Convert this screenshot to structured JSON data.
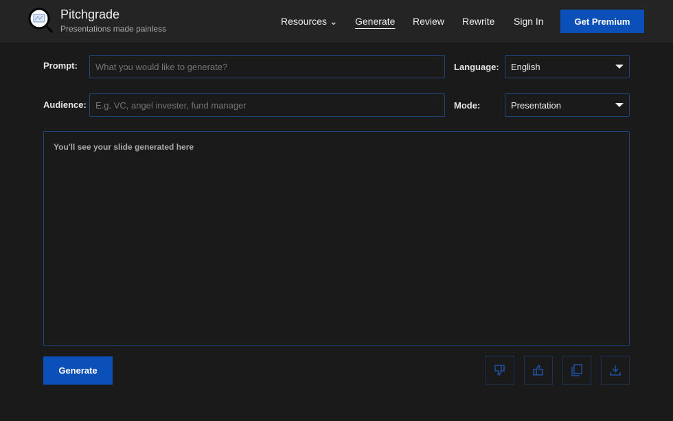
{
  "header": {
    "brand": "Pitchgrade",
    "tagline": "Presentations made painless",
    "nav": [
      {
        "label": "Resources"
      },
      {
        "label": "Generate"
      },
      {
        "label": "Review"
      },
      {
        "label": "Rewrite"
      },
      {
        "label": "Sign In"
      }
    ],
    "premium": "Get Premium"
  },
  "form": {
    "prompt_label": "Prompt:",
    "prompt_placeholder": "What you would like to generate?",
    "audience_label": "Audience:",
    "audience_placeholder": "E.g. VC, angel invester, fund manager",
    "language_label": "Language:",
    "language_value": "English",
    "mode_label": "Mode:",
    "mode_value": "Presentation"
  },
  "output": {
    "placeholder": "You'll see your slide generated here"
  },
  "actions": {
    "generate": "Generate",
    "icons": [
      "thumbs-down-icon",
      "thumbs-up-icon",
      "copy-icon",
      "download-icon"
    ]
  },
  "colors": {
    "accent": "#0b4fb8",
    "border": "#23447a"
  }
}
